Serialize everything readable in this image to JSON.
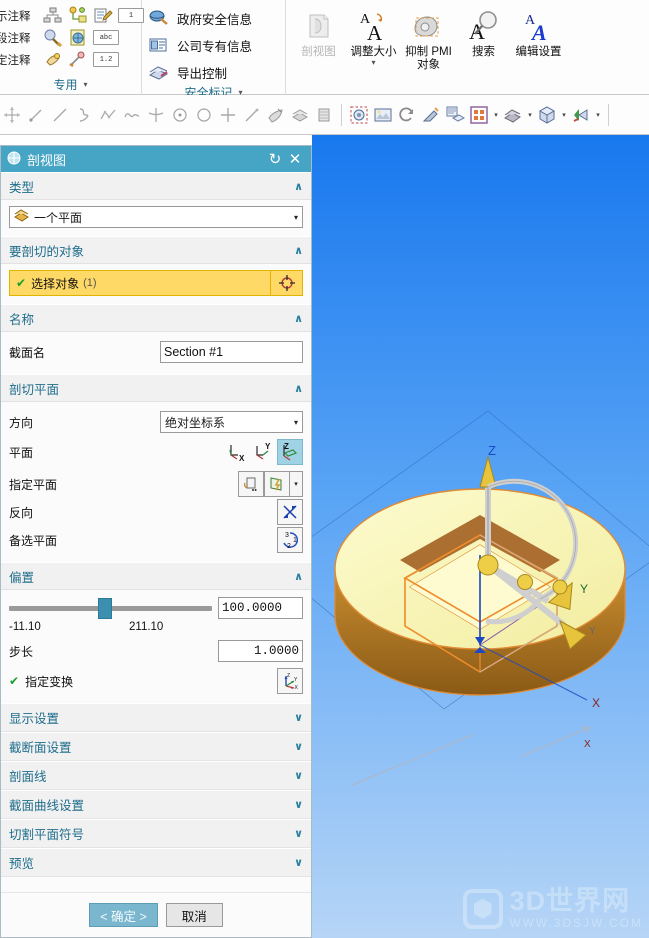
{
  "ribbon": {
    "groups": [
      {
        "name": "专用",
        "dropdown": "▾",
        "rows": [
          {
            "label": "示注释",
            "icons": [
              "org-chart-icon",
              "node-link-icon",
              "note-edit-icon"
            ],
            "box": "1"
          },
          {
            "label": "段注释",
            "icons": [
              "balloon-icon",
              "globe-note-icon"
            ],
            "box": "abc"
          },
          {
            "label": "定注释",
            "icons": [
              "hand-note-icon",
              "pin-note-icon"
            ],
            "box": "1.2"
          }
        ]
      },
      {
        "name": "安全标记",
        "dropdown": "▾",
        "items": [
          {
            "label": "政府安全信息",
            "icon": "gov-security-icon"
          },
          {
            "label": "公司专有信息",
            "icon": "company-proprietary-icon"
          },
          {
            "label": "导出控制",
            "icon": "export-control-icon"
          }
        ]
      },
      {
        "name": "",
        "buttons": [
          {
            "label": "剖视图",
            "icon": "section-view-icon",
            "disabled": true,
            "arrow": ""
          },
          {
            "label": "调整大小",
            "icon": "resize-text-icon",
            "disabled": false,
            "arrow": "▾"
          },
          {
            "label": "抑制 PMI 对象",
            "icon": "suppress-pmi-icon",
            "disabled": false,
            "arrow": ""
          },
          {
            "label": "搜索",
            "icon": "search-text-icon",
            "disabled": false,
            "arrow": ""
          },
          {
            "label": "编辑设置",
            "icon": "edit-settings-icon",
            "disabled": false,
            "arrow": ""
          }
        ]
      }
    ]
  },
  "toolbar": {
    "items": [
      {
        "icon": "move-object-icon"
      },
      {
        "icon": "point-icon"
      },
      {
        "icon": "line-icon"
      },
      {
        "icon": "spline-curve-icon"
      },
      {
        "icon": "polyline-icon"
      },
      {
        "icon": "wave-curve-icon"
      },
      {
        "icon": "arc-tangent-icon"
      },
      {
        "icon": "circle-center-icon"
      },
      {
        "icon": "circle-icon"
      },
      {
        "icon": "cross-point-icon"
      },
      {
        "icon": "edit-curve-icon"
      },
      {
        "icon": "sketch-icon"
      },
      {
        "icon": "surface-icon"
      },
      {
        "icon": "datum-plane-icon"
      },
      {
        "icon": "section-view-icon"
      },
      {
        "icon": "image-plane-icon"
      },
      {
        "icon": "rotate-icon"
      },
      {
        "icon": "paint-object-icon"
      },
      {
        "icon": "layer-settings-icon"
      },
      {
        "icon": "display-grid-icon",
        "arrow": "▾"
      },
      {
        "icon": "shade-style-icon",
        "arrow": "▾"
      },
      {
        "icon": "view-orientation-icon",
        "arrow": "▾"
      },
      {
        "icon": "render-style-icon",
        "arrow": "▾"
      }
    ]
  },
  "dialog": {
    "title": "剖视图",
    "title_icon": "section-view-icon",
    "reset_icon": "reset-icon",
    "close_icon": "close-icon",
    "sections": {
      "type": {
        "header": "类型",
        "chevron": "∧",
        "combo_value": "一个平面",
        "combo_icon": "one-plane-icon",
        "combo_arrow": "▾"
      },
      "objects": {
        "header": "要剖切的对象",
        "chevron": "∧",
        "select_label": "选择对象",
        "select_count": "(1)",
        "check": "✔",
        "pick_icon": "select-object-target-icon"
      },
      "name": {
        "header": "名称",
        "chevron": "∧",
        "label": "截面名",
        "value": "Section #1"
      },
      "plane": {
        "header": "剖切平面",
        "chevron": "∧",
        "direction_label": "方向",
        "direction_value": "绝对坐标系",
        "direction_arrow": "▾",
        "plane_label": "平面",
        "plane_buttons": [
          {
            "axis": "X",
            "icon": "plane-x-icon",
            "active": false
          },
          {
            "axis": "Y",
            "icon": "plane-y-icon",
            "active": false
          },
          {
            "axis": "Z",
            "icon": "plane-z-icon",
            "active": true
          }
        ],
        "specify_label": "指定平面",
        "specify_icon": "specify-plane-icon",
        "specify_icon2": "plane-construct-icon",
        "specify_arrow": "▾",
        "reverse_label": "反向",
        "reverse_icon": "reverse-direction-icon",
        "alternate_label": "备选平面",
        "alternate_icon": "alternate-plane-icon"
      },
      "offset": {
        "header": "偏置",
        "chevron": "∧",
        "min": "-11.10",
        "max": "211.10",
        "value": "100.0000",
        "step_label": "步长",
        "step_value": "1.0000",
        "transform_label": "指定变换",
        "transform_check": "✔",
        "transform_icon": "csys-triad-icon",
        "slider_percent": 44
      }
    },
    "collapsed_sections": [
      {
        "label": "显示设置",
        "chevron": "∨"
      },
      {
        "label": "截断面设置",
        "chevron": "∨"
      },
      {
        "label": "剖面线",
        "chevron": "∨"
      },
      {
        "label": "截面曲线设置",
        "chevron": "∨"
      },
      {
        "label": "切割平面符号",
        "chevron": "∨"
      },
      {
        "label": "预览",
        "chevron": "∨"
      }
    ],
    "footer": {
      "ok": "< 确定 >",
      "cancel": "取消"
    }
  },
  "viewport": {
    "axis_labels": {
      "z": "Z",
      "y": "Y",
      "x": "X",
      "x2": "X",
      "y2": "Y"
    },
    "watermark": {
      "title": "3D世界网",
      "url": "WWW.3DSJW.COM"
    }
  },
  "colors": {
    "title_bar": "#46a4c4",
    "section_header_text": "#1f6d8c",
    "selection_highlight": "#ffd966",
    "active_plane": "#9fd2e4",
    "primary_button": "#7ab6ce",
    "viewport_top": "#1878ee",
    "viewport_bottom": "#b6d5f6",
    "part_top": "#fbf7b8",
    "part_side": "#b5711f",
    "part_outline": "#e08a33"
  }
}
